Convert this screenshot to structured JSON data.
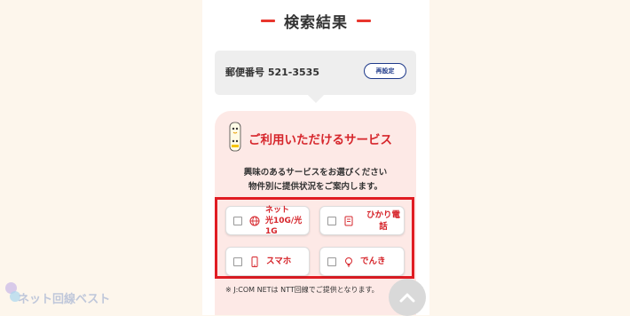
{
  "header": {
    "title": "検索結果"
  },
  "postal": {
    "label": "郵便番号 521-3535",
    "reset_label": "再設定"
  },
  "services": {
    "heading": "ご利用いただけるサービス",
    "intro_line1": "興味のあるサービスをお選びください",
    "intro_line2": "物件別に提供状況をご案内します。",
    "options": [
      {
        "label": "ネット\n光10G/光\n1G",
        "icon": "globe-icon"
      },
      {
        "label": "ひかり電\n話",
        "icon": "phone-icon"
      },
      {
        "label": "スマホ",
        "icon": "smartphone-icon"
      },
      {
        "label": "でんき",
        "icon": "lightbulb-icon"
      }
    ],
    "note": "※ J:COM NETは NTT回線でご提供となります。"
  },
  "watermark": {
    "text": "ネット回線ベスト"
  },
  "colors": {
    "accent_red": "#d6252b",
    "highlight_red": "#e01c23",
    "panel_pink": "#fde9e6",
    "navy": "#1f3a8a"
  }
}
